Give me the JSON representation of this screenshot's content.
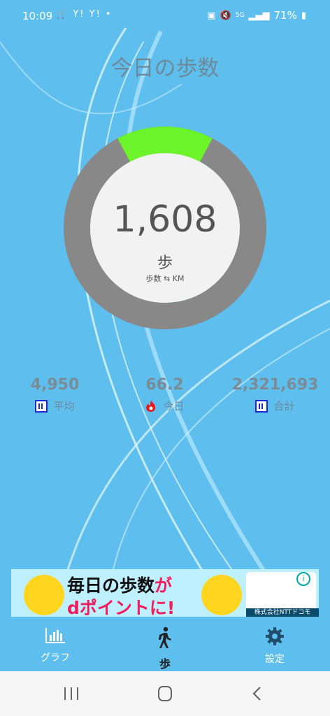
{
  "status_bar": {
    "time": "10:09",
    "left_icons": [
      "cart-icon",
      "yahoo-icon",
      "yahoo-icon",
      "dot-icon"
    ],
    "network": "5G",
    "battery": "71%"
  },
  "title": "今日の歩数",
  "progress": {
    "fraction": 0.155,
    "fill_color": "#6cf32a",
    "track_color": "#888888"
  },
  "steps": {
    "count": "1,608",
    "unit": "歩",
    "toggle_label": "歩数 ⇆ KM"
  },
  "stats": [
    {
      "value": "4,950",
      "label": "平均",
      "icon": "average-chart-icon"
    },
    {
      "value": "66.2",
      "label": "今日",
      "icon": "flame-icon"
    },
    {
      "value": "2,321,693",
      "label": "合計",
      "icon": "total-grid-icon"
    }
  ],
  "ad": {
    "line1a": "毎日の歩数",
    "line1b": "が",
    "line2a": "dポイント",
    "line2b": "に!",
    "caption": "株式会社NTTドコモ"
  },
  "bottom_nav": [
    {
      "label": "グラフ",
      "icon": "bar-chart-icon",
      "active": false
    },
    {
      "label": "歩",
      "icon": "walking-person-icon",
      "active": true
    },
    {
      "label": "設定",
      "icon": "gear-icon",
      "active": false
    }
  ],
  "colors": {
    "background": "#5ebfee",
    "accent_green": "#6cf32a"
  }
}
